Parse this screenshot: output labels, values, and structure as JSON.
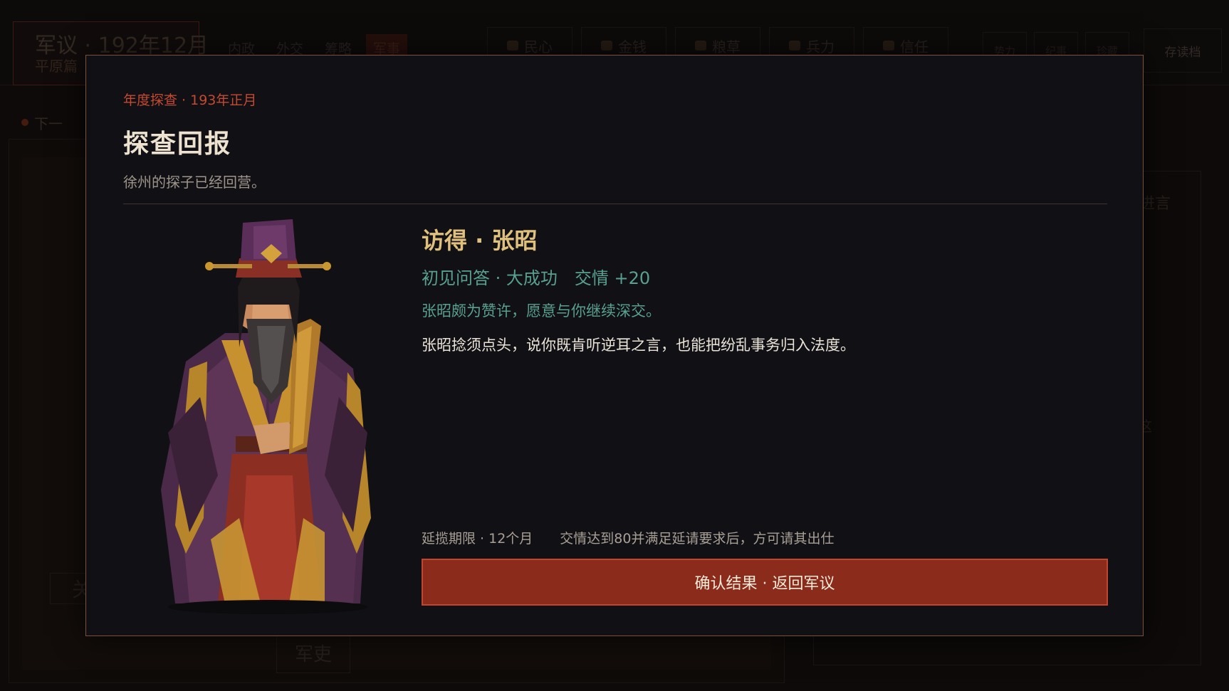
{
  "background": {
    "title": "军议 · 192年12月",
    "subtitle": "平原篇",
    "tabs": [
      "内政",
      "外交",
      "筹略",
      "军事"
    ],
    "stats": [
      {
        "label": "民心",
        "icon": "people-icon"
      },
      {
        "label": "金钱",
        "icon": "coin-icon"
      },
      {
        "label": "粮草",
        "icon": "grain-icon"
      },
      {
        "label": "兵力",
        "icon": "soldier-icon"
      },
      {
        "label": "信任",
        "icon": "trust-icon"
      }
    ],
    "buttons": [
      "势力",
      "纪事",
      "珍藏"
    ],
    "save_label": "存读档",
    "next_label": "下一",
    "advice_label": "进言",
    "fragment": "这",
    "guan_label": "关",
    "junli_label": "军吏"
  },
  "modal": {
    "eyebrow": "年度探查 · 193年正月",
    "title": "探查回报",
    "subtitle": "徐州的探子已经回营。",
    "character": {
      "name": "访得 · 张昭",
      "result": "初见问答 · 大成功",
      "favor": "交情 +20",
      "reaction": "张昭颇为赞许，愿意与你继续深交。",
      "narration": "张昭捻须点头，说你既肯听逆耳之言，也能把纷乱事务归入法度。"
    },
    "deadline": "延揽期限 · 12个月",
    "requirement": "交情达到80并满足延请要求后，方可请其出仕",
    "confirm_label": "确认结果 · 返回军议"
  },
  "colors": {
    "accent_red": "#c44a30",
    "gold": "#e0c07d",
    "teal": "#58a090",
    "button_bg": "#8a2b1c"
  }
}
